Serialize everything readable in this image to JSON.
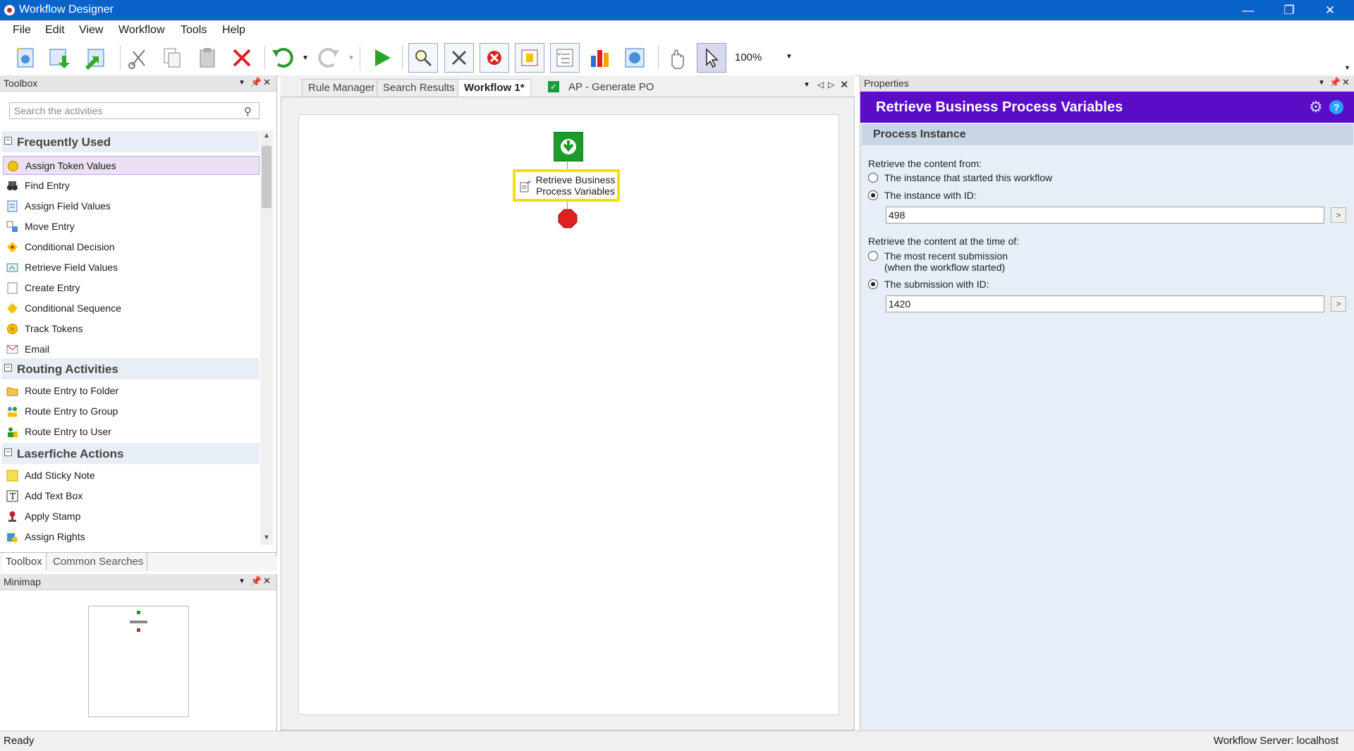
{
  "window": {
    "title": "Workflow Designer"
  },
  "menu": [
    "File",
    "Edit",
    "View",
    "Workflow",
    "Tools",
    "Help"
  ],
  "toolbar": {
    "zoom": "100%"
  },
  "toolbox": {
    "title": "Toolbox",
    "search_placeholder": "Search the activities",
    "groups": [
      {
        "label": "Frequently Used",
        "items": [
          "Assign Token Values",
          "Find Entry",
          "Assign Field Values",
          "Move Entry",
          "Conditional Decision",
          "Retrieve Field Values",
          "Create Entry",
          "Conditional Sequence",
          "Track Tokens",
          "Email"
        ]
      },
      {
        "label": "Routing Activities",
        "items": [
          "Route Entry to Folder",
          "Route Entry to Group",
          "Route Entry to User"
        ]
      },
      {
        "label": "Laserfiche Actions",
        "items": [
          "Add Sticky Note",
          "Add Text Box",
          "Apply Stamp",
          "Assign Rights"
        ]
      }
    ],
    "tabs": [
      "Toolbox",
      "Common Searches"
    ]
  },
  "minimap": {
    "title": "Minimap"
  },
  "doc_tabs": [
    "Rule Manager",
    "Search Results",
    "Workflow 1*",
    "AP - Generate PO"
  ],
  "canvas": {
    "activity_label": "Retrieve Business Process Variables"
  },
  "properties": {
    "panel_title": "Properties",
    "title": "Retrieve Business Process Variables",
    "section": "Process Instance",
    "content_from_label": "Retrieve the content from:",
    "opt_started": "The instance that started this workflow",
    "opt_instance_id": "The instance with ID:",
    "instance_id": "498",
    "time_label": "Retrieve the content at the time of:",
    "opt_recent": "The most recent submission",
    "opt_recent_sub": "(when the workflow started)",
    "opt_submission_id": "The submission with ID:",
    "submission_id": "1420",
    "arrow": ">"
  },
  "status": {
    "left": "Ready",
    "right": "Workflow Server: localhost"
  }
}
